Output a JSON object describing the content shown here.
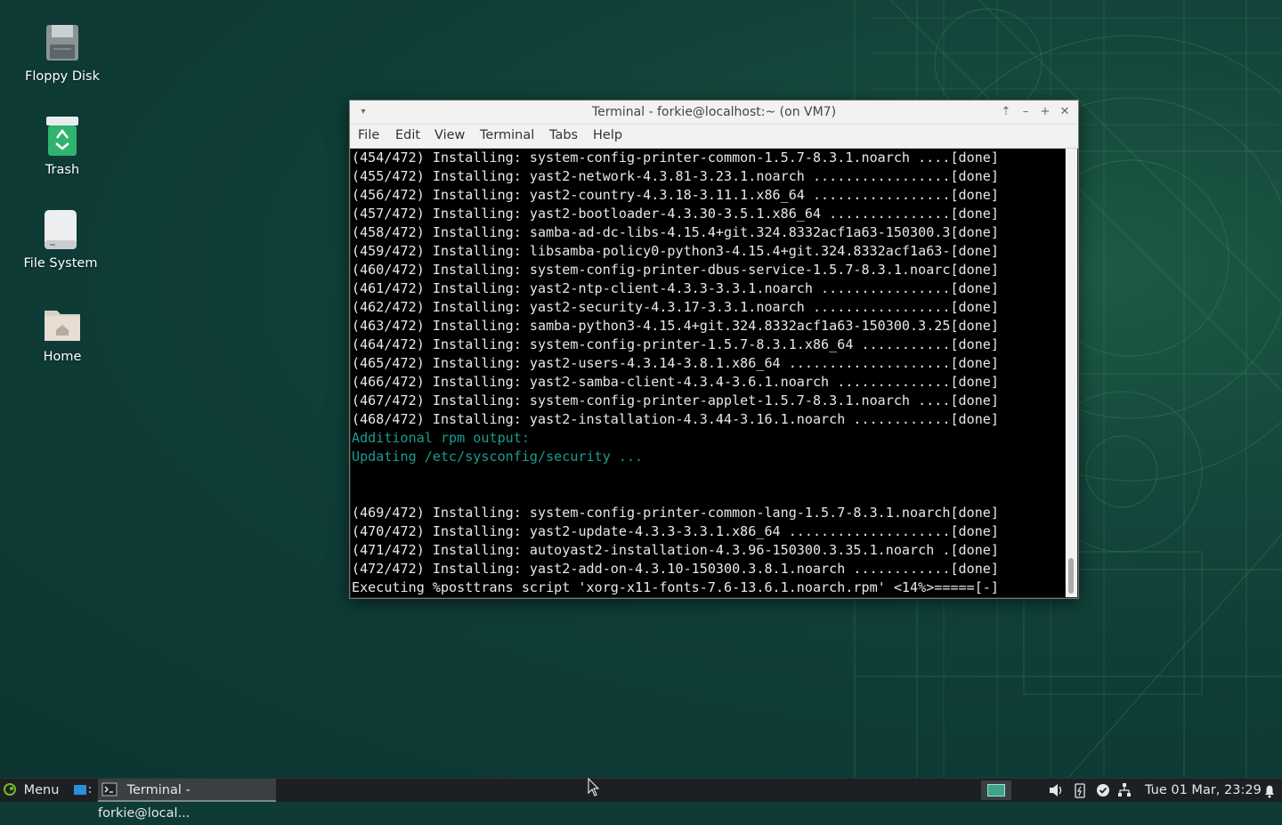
{
  "desktop": {
    "icons": [
      {
        "label": "Floppy Disk",
        "icon": "floppy-disk-icon"
      },
      {
        "label": "Trash",
        "icon": "trash-icon"
      },
      {
        "label": "File System",
        "icon": "drive-icon"
      },
      {
        "label": "Home",
        "icon": "home-folder-icon"
      }
    ]
  },
  "terminal": {
    "title": "Terminal - forkie@localhost:~ (on VM7)",
    "menu": [
      "File",
      "Edit",
      "View",
      "Terminal",
      "Tabs",
      "Help"
    ],
    "lines": [
      "(454/472) Installing: system-config-printer-common-1.5.7-8.3.1.noarch ....[done]",
      "(455/472) Installing: yast2-network-4.3.81-3.23.1.noarch .................[done]",
      "(456/472) Installing: yast2-country-4.3.18-3.11.1.x86_64 .................[done]",
      "(457/472) Installing: yast2-bootloader-4.3.30-3.5.1.x86_64 ...............[done]",
      "(458/472) Installing: samba-ad-dc-libs-4.15.4+git.324.8332acf1a63-150300.3[done]",
      "(459/472) Installing: libsamba-policy0-python3-4.15.4+git.324.8332acf1a63-[done]",
      "(460/472) Installing: system-config-printer-dbus-service-1.5.7-8.3.1.noarc[done]",
      "(461/472) Installing: yast2-ntp-client-4.3.3-3.3.1.noarch ................[done]",
      "(462/472) Installing: yast2-security-4.3.17-3.3.1.noarch .................[done]",
      "(463/472) Installing: samba-python3-4.15.4+git.324.8332acf1a63-150300.3.25[done]",
      "(464/472) Installing: system-config-printer-1.5.7-8.3.1.x86_64 ...........[done]",
      "(465/472) Installing: yast2-users-4.3.14-3.8.1.x86_64 ....................[done]",
      "(466/472) Installing: yast2-samba-client-4.3.4-3.6.1.noarch ..............[done]",
      "(467/472) Installing: system-config-printer-applet-1.5.7-8.3.1.noarch ....[done]",
      "(468/472) Installing: yast2-installation-4.3.44-3.16.1.noarch ............[done]",
      "Additional rpm output:",
      "Updating /etc/sysconfig/security ...",
      "",
      "",
      "(469/472) Installing: system-config-printer-common-lang-1.5.7-8.3.1.noarch[done]",
      "(470/472) Installing: yast2-update-4.3.3-3.3.1.x86_64 ....................[done]",
      "(471/472) Installing: autoyast2-installation-4.3.96-150300.3.35.1.noarch .[done]",
      "(472/472) Installing: yast2-add-on-4.3.10-150300.3.8.1.noarch ............[done]",
      "Executing %posttrans script 'xorg-x11-fonts-7.6-13.6.1.noarch.rpm' <14%>=====[-]"
    ],
    "highlight_color": "#1a9c8f"
  },
  "taskbar": {
    "menu_label": "Menu",
    "task_label": "Terminal - forkie@local...",
    "clock": "Tue 01 Mar, 23:29"
  }
}
